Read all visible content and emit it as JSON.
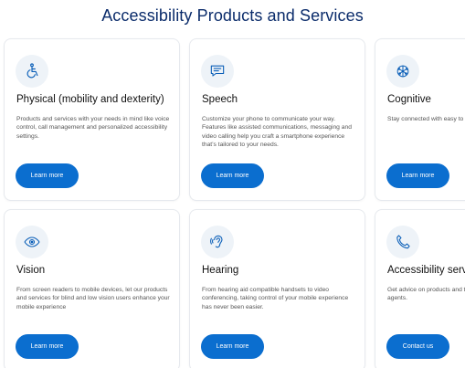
{
  "page": {
    "title": "Accessibility Products and Services"
  },
  "colors": {
    "title": "#0b2c6b",
    "button": "#0b6ecf",
    "icon": "#0b5fb8",
    "icon_bg": "#eef3f8"
  },
  "cards": [
    {
      "icon": "wheelchair-icon",
      "title": "Physical (mobility and dexterity)",
      "description": "Products and services with your needs in mind like voice control, call management and personalized accessibility settings.",
      "button": "Learn more"
    },
    {
      "icon": "chat-bubble-icon",
      "title": "Speech",
      "description": "Customize your phone to communicate your way. Features like assisted communications, messaging and video calling help you craft a smartphone experience that’s tailored to your needs.",
      "button": "Learn more"
    },
    {
      "icon": "brain-network-icon",
      "title": "Cognitive",
      "description": "Stay connected with easy to controls, alerts and reminde",
      "button": "Learn more"
    },
    {
      "icon": "eye-icon",
      "title": "Vision",
      "description": "From screen readers to mobile devices, let our products and services for blind and low vision users enhance your mobile experience",
      "button": "Learn more"
    },
    {
      "icon": "hearing-icon",
      "title": "Hearing",
      "description": "From hearing aid compatible handsets to video conferencing, taking control of your mobile experience has never been easier.",
      "button": "Learn more"
    },
    {
      "icon": "phone-icon",
      "title": "Accessibility serv",
      "description": "Get advice on products and to your questions, from our agents.",
      "button": "Contact us"
    }
  ]
}
